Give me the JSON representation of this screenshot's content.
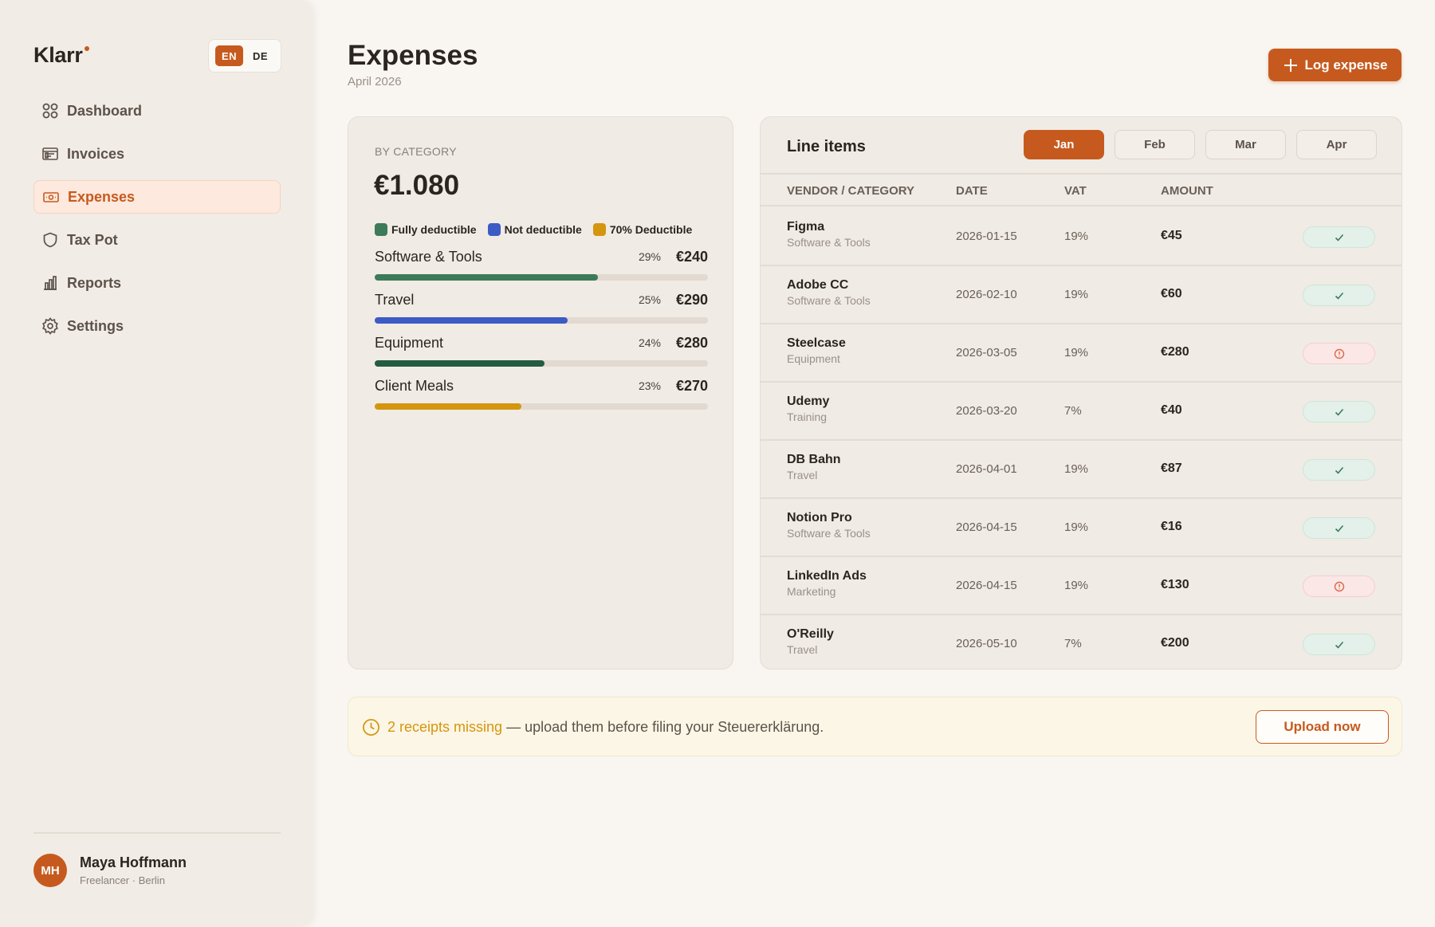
{
  "app": {
    "logo": "Klarr"
  },
  "lang": {
    "en": "EN",
    "de": "DE",
    "active": "EN"
  },
  "sidebar": {
    "items": [
      {
        "label": "Dashboard",
        "icon": "grid-icon",
        "active": false
      },
      {
        "label": "Invoices",
        "icon": "invoice-icon",
        "active": false
      },
      {
        "label": "Expenses",
        "icon": "banknote-icon",
        "active": true
      },
      {
        "label": "Tax Pot",
        "icon": "shield-icon",
        "active": false
      },
      {
        "label": "Reports",
        "icon": "bar-chart-icon",
        "active": false
      },
      {
        "label": "Settings",
        "icon": "gear-icon",
        "active": false
      }
    ]
  },
  "user": {
    "initials": "MH",
    "name": "Maya Hoffmann",
    "subtitle": "Freelancer · Berlin"
  },
  "header": {
    "title": "Expenses",
    "subtitle": "April 2026",
    "log_button": "Log expense"
  },
  "categories": {
    "label": "BY CATEGORY",
    "total": "€1.080",
    "legend": [
      {
        "label": "Fully deductible",
        "color": "#3d7a5a"
      },
      {
        "label": "Not deductible",
        "color": "#3c5bc4"
      },
      {
        "label": "70% Deductible",
        "color": "#d4960e"
      }
    ],
    "rows": [
      {
        "name": "Software & Tools",
        "pct": "29%",
        "amount": "€240",
        "fill": 0.67,
        "color": "#3d7a5a"
      },
      {
        "name": "Travel",
        "pct": "25%",
        "amount": "€290",
        "fill": 0.58,
        "color": "#3c5bc4"
      },
      {
        "name": "Equipment",
        "pct": "24%",
        "amount": "€280",
        "fill": 0.51,
        "color": "#245c3f"
      },
      {
        "name": "Client Meals",
        "pct": "23%",
        "amount": "€270",
        "fill": 0.44,
        "color": "#d4960e"
      }
    ]
  },
  "line_items": {
    "title": "Line items",
    "months": [
      "Jan",
      "Feb",
      "Mar",
      "Apr"
    ],
    "active_month": "Jan",
    "columns": {
      "vendor": "VENDOR / CATEGORY",
      "date": "DATE",
      "vat": "VAT",
      "amount": "AMOUNT"
    },
    "rows": [
      {
        "vendor": "Figma",
        "category": "Software & Tools",
        "date": "2026-01-15",
        "vat": "19%",
        "amount": "€45",
        "status": "ok"
      },
      {
        "vendor": "Adobe CC",
        "category": "Software & Tools",
        "date": "2026-02-10",
        "vat": "19%",
        "amount": "€60",
        "status": "ok"
      },
      {
        "vendor": "Steelcase",
        "category": "Equipment",
        "date": "2026-03-05",
        "vat": "19%",
        "amount": "€280",
        "status": "warn"
      },
      {
        "vendor": "Udemy",
        "category": "Training",
        "date": "2026-03-20",
        "vat": "7%",
        "amount": "€40",
        "status": "ok"
      },
      {
        "vendor": "DB Bahn",
        "category": "Travel",
        "date": "2026-04-01",
        "vat": "19%",
        "amount": "€87",
        "status": "ok"
      },
      {
        "vendor": "Notion Pro",
        "category": "Software & Tools",
        "date": "2026-04-15",
        "vat": "19%",
        "amount": "€16",
        "status": "ok"
      },
      {
        "vendor": "LinkedIn Ads",
        "category": "Marketing",
        "date": "2026-04-15",
        "vat": "19%",
        "amount": "€130",
        "status": "warn"
      },
      {
        "vendor": "O'Reilly",
        "category": "Travel",
        "date": "2026-05-10",
        "vat": "7%",
        "amount": "€200",
        "status": "ok"
      }
    ]
  },
  "banner": {
    "highlight": "2 receipts missing",
    "text": " — upload them before filing your Steuererklärung.",
    "button": "Upload now"
  },
  "colors": {
    "accent": "#c65a1e",
    "ok": "#3d7a5a",
    "warn": "#d96a4a",
    "notice": "#d4960e"
  }
}
